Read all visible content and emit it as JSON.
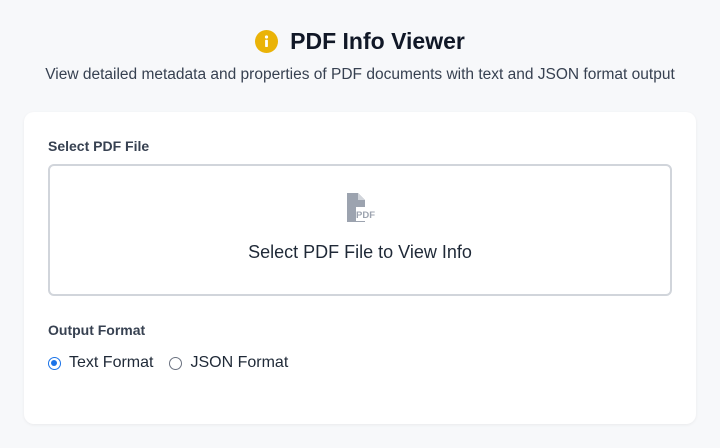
{
  "header": {
    "title": "PDF Info Viewer",
    "subtitle": "View detailed metadata and properties of PDF documents with text and JSON format output",
    "icon": "info-icon",
    "icon_color": "#eab308"
  },
  "file_select": {
    "label": "Select PDF File",
    "dropzone_text": "Select PDF File to View Info",
    "icon": "pdf-file-icon",
    "icon_text": "PDF"
  },
  "output_format": {
    "label": "Output Format",
    "options": [
      {
        "label": "Text Format",
        "selected": true
      },
      {
        "label": "JSON Format",
        "selected": false
      }
    ]
  },
  "colors": {
    "accent": "#1a73e8",
    "background": "#f7f8fa",
    "card": "#ffffff"
  }
}
